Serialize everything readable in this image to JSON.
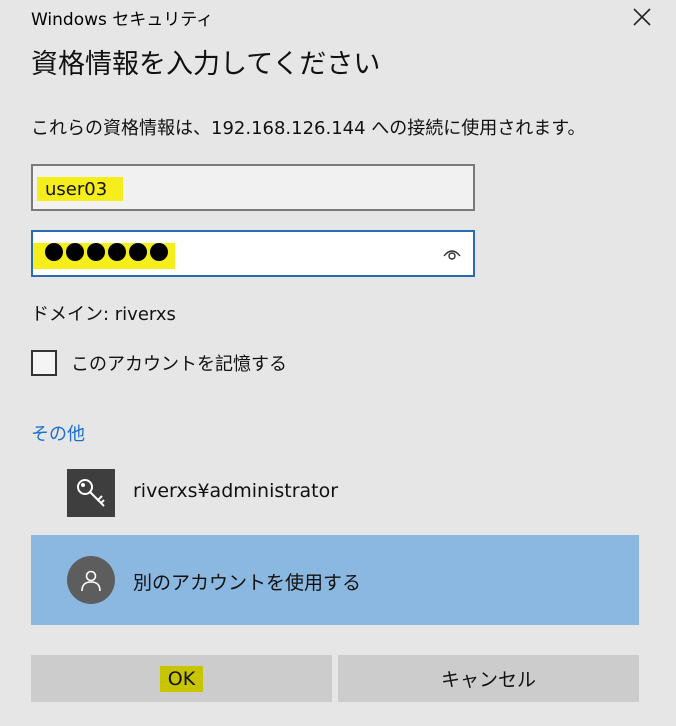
{
  "window": {
    "title": "Windows セキュリティ"
  },
  "dialog": {
    "heading": "資格情報を入力してください",
    "message": "これらの資格情報は、192.168.126.144 への接続に使用されます。"
  },
  "username_field": {
    "value": "user03"
  },
  "password_field": {
    "mask_length": 6
  },
  "domain_line": "ドメイン: riverxs",
  "remember_checkbox": {
    "label": "このアカウントを記憶する",
    "checked": false
  },
  "more_choices": {
    "label": "その他"
  },
  "accounts": [
    {
      "label": "riverxs¥administrator",
      "icon": "key-icon"
    },
    {
      "label": "別のアカウントを使用する",
      "icon": "person-icon",
      "selected": true
    }
  ],
  "buttons": {
    "ok": "OK",
    "cancel": "キャンセル"
  },
  "colors": {
    "background": "#e6e6e6",
    "link": "#1a6fd6",
    "selected_row": "#8ab8e0",
    "field_focus_border": "#2b6cb0",
    "highlight": "#f5ee1b",
    "ok_highlight": "#c8c400"
  }
}
